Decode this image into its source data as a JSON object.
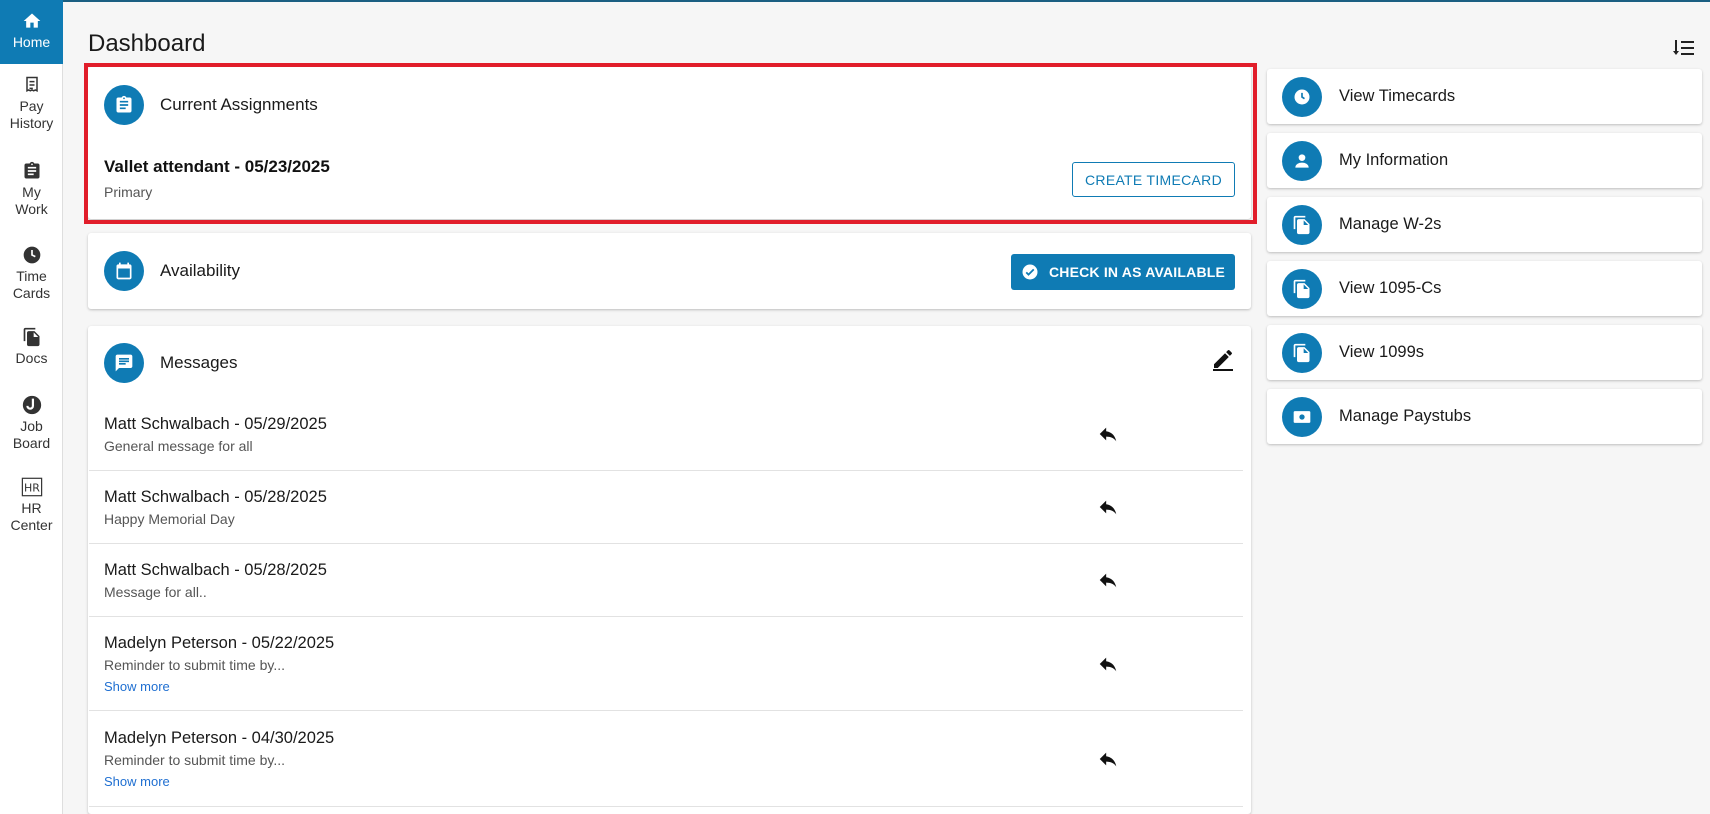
{
  "sidebar": {
    "items": [
      {
        "label": "Home",
        "icon": "home-icon",
        "active": true
      },
      {
        "label": "Pay\nHistory",
        "icon": "receipt-icon"
      },
      {
        "label": "My\nWork",
        "icon": "clipboard-icon"
      },
      {
        "label": "Time\nCards",
        "icon": "clock-icon"
      },
      {
        "label": "Docs",
        "icon": "documents-icon"
      },
      {
        "label": "Job\nBoard",
        "icon": "job-board-icon"
      },
      {
        "label": "HR\nCenter",
        "icon": "hr-icon"
      }
    ]
  },
  "header": {
    "title": "Dashboard"
  },
  "assignments": {
    "title": "Current Assignments",
    "name": "Vallet attendant - 05/23/2025",
    "type": "Primary",
    "button": "CREATE TIMECARD"
  },
  "availability": {
    "title": "Availability",
    "button": "CHECK IN AS AVAILABLE"
  },
  "messages": {
    "title": "Messages",
    "items": [
      {
        "header": "Matt Schwalbach - 05/29/2025",
        "body": "General message for all"
      },
      {
        "header": "Matt Schwalbach - 05/28/2025",
        "body": "Happy Memorial Day"
      },
      {
        "header": "Matt Schwalbach - 05/28/2025",
        "body": "Message for all.."
      },
      {
        "header": "Madelyn Peterson - 05/22/2025",
        "body": "Reminder to submit time by...",
        "more": "Show more"
      },
      {
        "header": "Madelyn Peterson - 04/30/2025",
        "body": "Reminder to submit time by...",
        "more": "Show more"
      }
    ]
  },
  "quick_links": [
    {
      "label": "View Timecards",
      "icon": "clock-icon"
    },
    {
      "label": "My Information",
      "icon": "person-icon"
    },
    {
      "label": "Manage W-2s",
      "icon": "document-copy-icon"
    },
    {
      "label": "View 1095-Cs",
      "icon": "document-copy-icon"
    },
    {
      "label": "View 1099s",
      "icon": "document-copy-icon"
    },
    {
      "label": "Manage Paystubs",
      "icon": "money-icon"
    }
  ],
  "colors": {
    "accent": "#0f7bb4",
    "highlight": "#e11d2a",
    "link": "#1f6fd1"
  }
}
